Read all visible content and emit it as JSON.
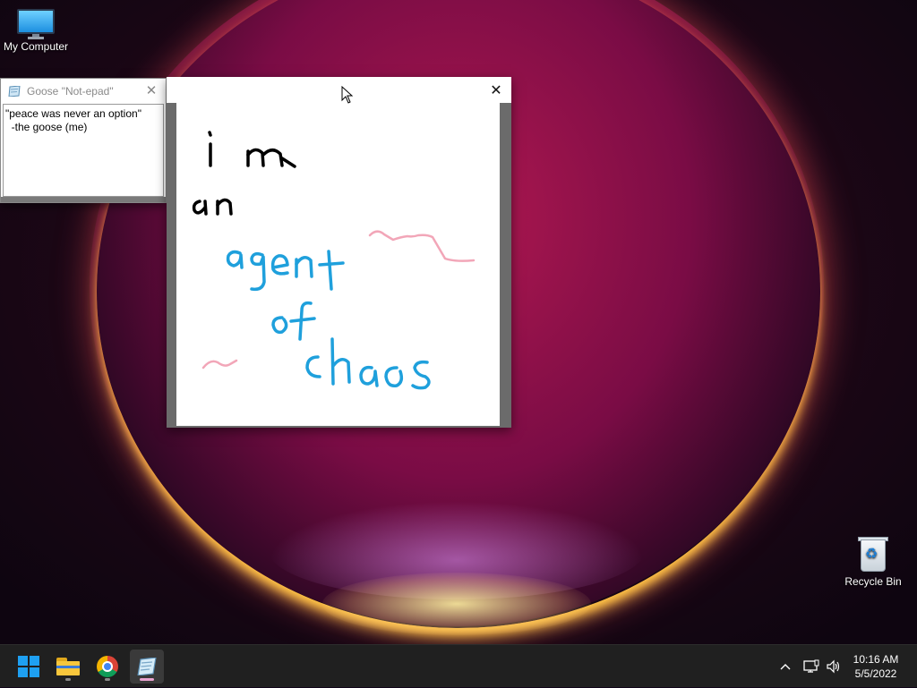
{
  "desktop": {
    "icons": [
      {
        "label": "My Computer",
        "icon": "monitor-icon"
      },
      {
        "label": "Recycle Bin",
        "icon": "recycle-bin-icon"
      }
    ]
  },
  "notepad_window": {
    "title": "Goose \"Not-epad\"",
    "close_glyph": "✕",
    "lines": [
      "\"peace was never an option\"",
      "  -the goose (me)"
    ]
  },
  "paint_window": {
    "close_glyph": "✕",
    "drawing": {
      "black_text": "i m an",
      "blue_text": "agent of chaos",
      "colors": {
        "black": "#000000",
        "blue": "#1fa0dc",
        "pink": "#f2a6b8"
      }
    }
  },
  "taskbar": {
    "items": [
      {
        "name": "start-button",
        "icon": "windows-logo-icon"
      },
      {
        "name": "file-explorer",
        "icon": "folder-icon"
      },
      {
        "name": "chrome",
        "icon": "chrome-icon"
      },
      {
        "name": "notepad",
        "icon": "notepad-icon",
        "active": true
      }
    ],
    "tray": {
      "chevron": "^",
      "time": "10:16 AM",
      "date": "5/5/2022"
    }
  },
  "colors": {
    "taskbar": "#202020",
    "accent": "#1ea0f2"
  }
}
